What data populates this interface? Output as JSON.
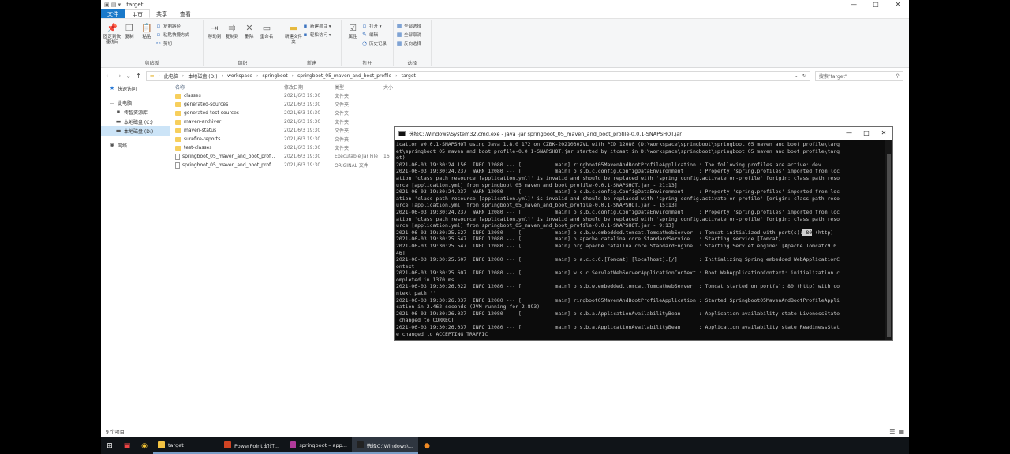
{
  "explorer": {
    "title": "target",
    "window_controls": [
      "—",
      "□",
      "✕"
    ],
    "tabs": [
      {
        "label": "文件",
        "kind": "file"
      },
      {
        "label": "主页",
        "kind": "active"
      },
      {
        "label": "共享",
        "kind": ""
      },
      {
        "label": "查看",
        "kind": ""
      }
    ],
    "ribbon": {
      "clipboard": {
        "group_label": "剪贴板",
        "pin": "固定到快速访问",
        "copy": "复制",
        "paste": "粘贴",
        "copy_path": "复制路径",
        "paste_shortcut": "粘贴快捷方式",
        "cut": "剪切"
      },
      "organize": {
        "group_label": "组织",
        "move_to": "移动到",
        "copy_to": "复制到",
        "delete": "删除",
        "rename": "重命名"
      },
      "new": {
        "group_label": "新建",
        "new_folder": "新建文件夹",
        "new_item": "新建项目 ▾",
        "easy_access": "轻松访问 ▾"
      },
      "open": {
        "group_label": "打开",
        "properties": "属性",
        "open": "打开 ▾",
        "edit": "编辑",
        "history": "历史记录"
      },
      "select": {
        "group_label": "选择",
        "select_all": "全部选择",
        "select_none": "全部取消",
        "invert": "反向选择"
      }
    },
    "address": {
      "crumbs": [
        "此电脑",
        "本地磁盘 (D:)",
        "workspace",
        "springboot",
        "springboot_05_maven_and_boot_profile",
        "target"
      ],
      "search_placeholder": "搜索\"target\""
    },
    "nav": [
      {
        "label": "快速访问",
        "icon": "★",
        "selected": false,
        "indent": 0
      },
      {
        "label": "此电脑",
        "icon": "▭",
        "selected": false,
        "indent": 0
      },
      {
        "label": "传智资源库",
        "icon": "▪",
        "selected": false,
        "indent": 1
      },
      {
        "label": "本地磁盘 (C:)",
        "icon": "▬",
        "selected": false,
        "indent": 1
      },
      {
        "label": "本地磁盘 (D:)",
        "icon": "▬",
        "selected": true,
        "indent": 1
      },
      {
        "label": "网络",
        "icon": "◉",
        "selected": false,
        "indent": 0
      }
    ],
    "columns": {
      "name": "名称",
      "date": "修改日期",
      "type": "类型",
      "size": "大小"
    },
    "files": [
      {
        "name": "classes",
        "date": "2021/6/3 19:30",
        "type": "文件夹",
        "size": "",
        "kind": "folder"
      },
      {
        "name": "generated-sources",
        "date": "2021/6/3 19:30",
        "type": "文件夹",
        "size": "",
        "kind": "folder"
      },
      {
        "name": "generated-test-sources",
        "date": "2021/6/3 19:30",
        "type": "文件夹",
        "size": "",
        "kind": "folder"
      },
      {
        "name": "maven-archiver",
        "date": "2021/6/3 19:30",
        "type": "文件夹",
        "size": "",
        "kind": "folder"
      },
      {
        "name": "maven-status",
        "date": "2021/6/3 19:30",
        "type": "文件夹",
        "size": "",
        "kind": "folder"
      },
      {
        "name": "surefire-reports",
        "date": "2021/6/3 19:30",
        "type": "文件夹",
        "size": "",
        "kind": "folder"
      },
      {
        "name": "test-classes",
        "date": "2021/6/3 19:30",
        "type": "文件夹",
        "size": "",
        "kind": "folder"
      },
      {
        "name": "springboot_05_maven_and_boot_prof...",
        "date": "2021/6/3 19:30",
        "type": "Executable Jar File",
        "size": "16",
        "kind": "jar"
      },
      {
        "name": "springboot_05_maven_and_boot_prof...",
        "date": "2021/6/3 19:30",
        "type": "ORIGINAL 文件",
        "size": "",
        "kind": "file"
      }
    ],
    "status": "9 个项目"
  },
  "cmd": {
    "title": "选择C:\\Windows\\System32\\cmd.exe - java  -jar springboot_05_maven_and_boot_profile-0.0.1-SNAPSHOT.jar",
    "lines": [
      "ication v0.0.1-SNAPSHOT using Java 1.8.0_172 on CZBK-20210302VL with PID 12080 (D:\\workspace\\springboot\\springboot_05_maven_and_boot_profile\\targ",
      "et\\springboot_05_maven_and_boot_profile-0.0.1-SNAPSHOT.jar started by itcast in D:\\workspace\\springboot\\springboot_05_maven_and_boot_profile\\targ",
      "et)",
      "2021-06-03 19:30:24.156  INFO 12080 --- [           main] ringboot05MavenAndBootProfileApplication : The following profiles are active: dev",
      "2021-06-03 19:30:24.237  WARN 12080 --- [           main] o.s.b.c.config.ConfigDataEnvironment     : Property 'spring.profiles' imported from loc",
      "ation 'class path resource [application.yml]' is invalid and should be replaced with 'spring.config.activate.on-profile' [origin: class path reso",
      "urce [application.yml] from springboot_05_maven_and_boot_profile-0.0.1-SNAPSHOT.jar - 21:13]",
      "2021-06-03 19:30:24.237  WARN 12080 --- [           main] o.s.b.c.config.ConfigDataEnvironment     : Property 'spring.profiles' imported from loc",
      "ation 'class path resource [application.yml]' is invalid and should be replaced with 'spring.config.activate.on-profile' [origin: class path reso",
      "urce [application.yml] from springboot_05_maven_and_boot_profile-0.0.1-SNAPSHOT.jar - 15:13]",
      "2021-06-03 19:30:24.237  WARN 12080 --- [           main] o.s.b.c.config.ConfigDataEnvironment     : Property 'spring.profiles' imported from loc",
      "ation 'class path resource [application.yml]' is invalid and should be replaced with 'spring.config.activate.on-profile' [origin: class path reso",
      "urce [application.yml] from springboot_05_maven_and_boot_profile-0.0.1-SNAPSHOT.jar - 9:13]",
      "2021-06-03 19:30:25.527  INFO 12080 --- [           main] o.s.b.w.embedded.tomcat.TomcatWebServer  : Tomcat initialized with port(s): 80 (http)",
      "2021-06-03 19:30:25.547  INFO 12080 --- [           main] o.apache.catalina.core.StandardService   : Starting service [Tomcat]",
      "2021-06-03 19:30:25.547  INFO 12080 --- [           main] org.apache.catalina.core.StandardEngine  : Starting Servlet engine: [Apache Tomcat/9.0.",
      "46]",
      "2021-06-03 19:30:25.607  INFO 12080 --- [           main] o.a.c.c.C.[Tomcat].[localhost].[/]       : Initializing Spring embedded WebApplicationC",
      "ontext",
      "2021-06-03 19:30:25.607  INFO 12080 --- [           main] w.s.c.ServletWebServerApplicationContext : Root WebApplicationContext: initialization c",
      "ompleted in 1370 ms",
      "2021-06-03 19:30:26.022  INFO 12080 --- [           main] o.s.b.w.embedded.tomcat.TomcatWebServer  : Tomcat started on port(s): 80 (http) with co",
      "ntext path ''",
      "2021-06-03 19:30:26.037  INFO 12080 --- [           main] ringboot05MavenAndBootProfileApplication : Started Springboot05MavenAndBootProfileAppli",
      "cation in 2.462 seconds (JVM running for 2.893)",
      "2021-06-03 19:30:26.037  INFO 12080 --- [           main] o.s.b.a.ApplicationAvailabilityBean      : Application availability state LivenessState",
      " changed to CORRECT",
      "2021-06-03 19:30:26.037  INFO 12080 --- [           main] o.s.b.a.ApplicationAvailabilityBean      : Application availability state ReadinessStat",
      "e changed to ACCEPTING_TRAFFIC",
      "_"
    ],
    "highlight_line": 13,
    "highlight_text": "80"
  },
  "taskbar": {
    "apps": [
      {
        "label": "target",
        "color": "#f3c343",
        "active": false
      },
      {
        "label": "PowerPoint 幻灯...",
        "color": "#d04423",
        "active": false
      },
      {
        "label": "springboot – app...",
        "color": "#b03a9a",
        "active": false
      },
      {
        "label": "选择C:\\Windows\\...",
        "color": "#222222",
        "active": true
      }
    ]
  },
  "colors": {
    "accent": "#1979ca",
    "console_bg": "#0c0c0c",
    "console_fg": "#c7c7c7"
  }
}
